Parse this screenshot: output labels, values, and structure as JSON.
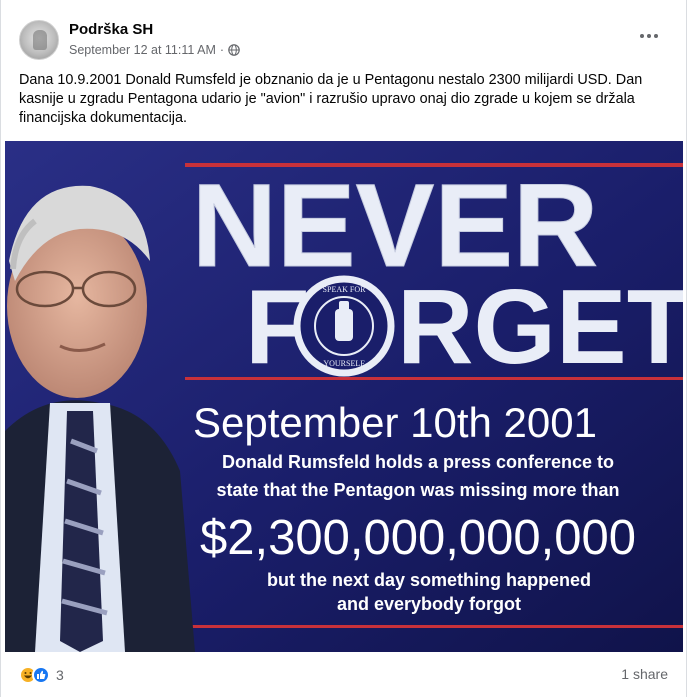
{
  "post": {
    "page_name": "Podrška SH",
    "timestamp": "September 12 at 11:11 AM",
    "separator": "·",
    "audience_icon": "globe-icon",
    "more_icon": "more-options-icon",
    "text": "Dana 10.9.2001 Donald Rumsfeld je obznanio da je u Pentagonu nestalo 2300 milijardi USD. Dan kasnije u zgradu Pentagona udario je \"avion\" i razrušio upravo onaj dio zgrade u kojem se držala financijska dokumentacija."
  },
  "image": {
    "headline_line1": "NEVER",
    "headline_f": "F",
    "headline_rest": "RGET",
    "seal_top_text": "SPEAK FOR",
    "seal_bottom_text": "YOURSELF",
    "date": "September 10th 2001",
    "line1": "Donald Rumsfeld holds a press conference to",
    "line2": "state that the Pentagon was missing more than",
    "amount": "$2,300,000,000,000",
    "line3": "but the next day something happened",
    "line4": "and everybody forgot"
  },
  "footer": {
    "reaction_icons": [
      "haha-icon",
      "like-icon"
    ],
    "reaction_count": "3",
    "shares": "1 share"
  },
  "colors": {
    "facebook_blue": "#1877f2",
    "poster_blue": "#1b1f6b",
    "poster_red": "#c8313a"
  }
}
